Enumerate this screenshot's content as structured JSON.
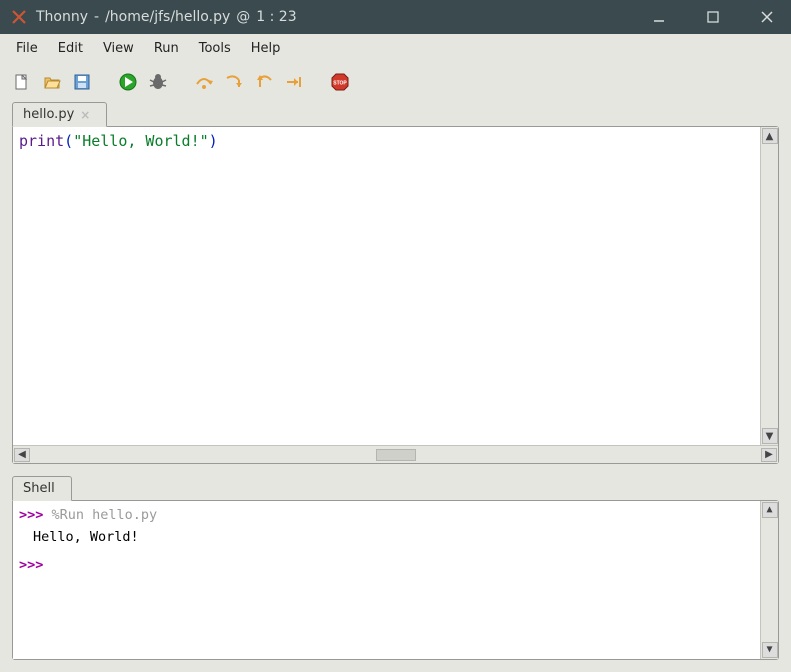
{
  "titlebar": {
    "app_name": "Thonny",
    "separator": "  -  ",
    "file_path": "/home/jfs/hello.py",
    "cursor_sep": "  @  ",
    "cursor_pos": "1 : 23"
  },
  "menubar": {
    "items": [
      "File",
      "Edit",
      "View",
      "Run",
      "Tools",
      "Help"
    ]
  },
  "toolbar": {
    "new_file": "new-file-icon",
    "open_file": "open-file-icon",
    "save_file": "save-file-icon",
    "run": "run-icon",
    "debug": "debug-icon",
    "step_over": "step-over-icon",
    "step_into": "step-into-icon",
    "step_out": "step-out-icon",
    "resume": "resume-icon",
    "stop": "stop-icon"
  },
  "editor": {
    "tab_label": "hello.py",
    "code": {
      "fn": "print",
      "open_paren": "(",
      "string": "\"Hello, World!\"",
      "close_paren": ")"
    }
  },
  "shell": {
    "tab_label": "Shell",
    "prompt": ">>> ",
    "run_line": "%Run hello.py",
    "output": "Hello, World!",
    "prompt2": ">>> "
  },
  "colors": {
    "title_bg": "#3a4a4f"
  }
}
